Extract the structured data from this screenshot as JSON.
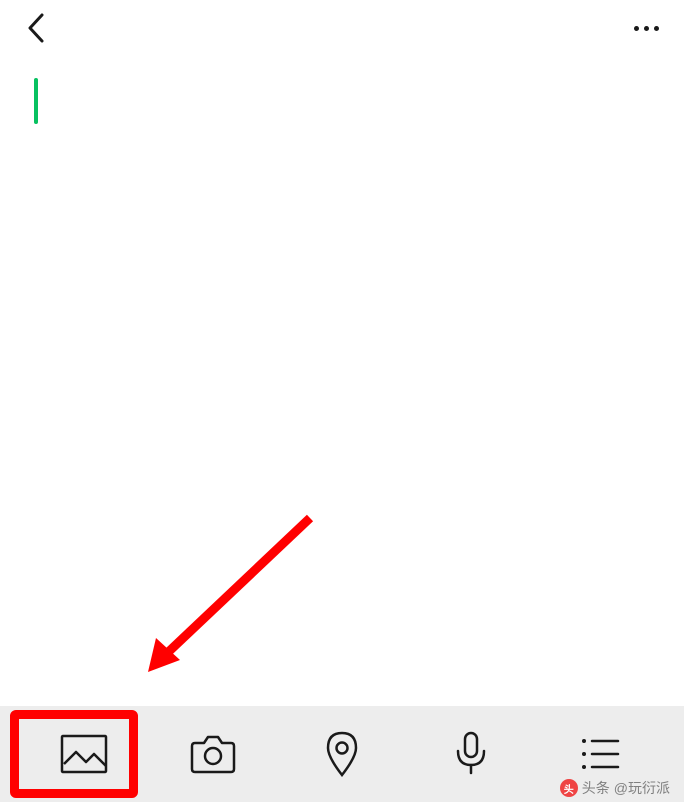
{
  "header": {
    "back": "back",
    "more": "more"
  },
  "editor": {
    "content": ""
  },
  "toolbar": {
    "items": [
      {
        "name": "image-icon"
      },
      {
        "name": "camera-icon"
      },
      {
        "name": "location-icon"
      },
      {
        "name": "voice-icon"
      },
      {
        "name": "list-icon"
      }
    ]
  },
  "annotation": {
    "highlight_target": "image-icon",
    "arrow_color": "#ff0000"
  },
  "watermark": {
    "prefix": "头条",
    "text": "@玩衍派"
  }
}
